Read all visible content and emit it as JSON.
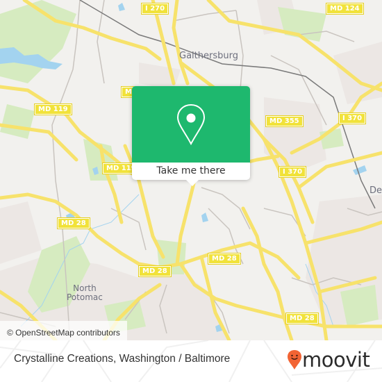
{
  "map": {
    "colors": {
      "land": "#f2f1ee",
      "park": "#d6ebc0",
      "water": "#a3d3ef",
      "residential": "#ece7e4",
      "major_road": "#f7e26b",
      "minor_road": "#c9c4bf",
      "rail": "#7a7a7a"
    },
    "place_labels": [
      {
        "name": "Gaithersburg",
        "kind": "city"
      },
      {
        "name": "North\nPotomac",
        "kind": "town"
      },
      {
        "name": "De",
        "kind": "city"
      }
    ],
    "road_shields": [
      {
        "label": "I 270"
      },
      {
        "label": "MD 124"
      },
      {
        "label": "MD 119"
      },
      {
        "label": "MD 119"
      },
      {
        "label": "MD"
      },
      {
        "label": "MD 355"
      },
      {
        "label": "I 370"
      },
      {
        "label": "I 370"
      },
      {
        "label": "MD 28"
      },
      {
        "label": "MD 28"
      },
      {
        "label": "MD 28"
      },
      {
        "label": "MD 28"
      }
    ],
    "attribution": "© OpenStreetMap contributors"
  },
  "popup": {
    "icon": "map-pin-icon",
    "button_label": "Take me there",
    "color": "#1eb86e"
  },
  "footer": {
    "title": "Crystalline Creations, Washington / Baltimore",
    "logo": {
      "text": "moovit",
      "icon": "moovit-smiley-pin-icon",
      "color": "#f26434"
    }
  }
}
